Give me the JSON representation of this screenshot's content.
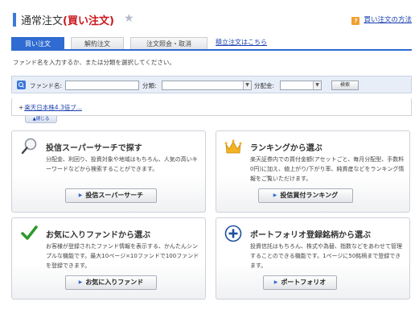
{
  "header": {
    "title_prefix": "通常注文",
    "title_emphasis": "(買い注文)",
    "star_icon": "star-icon",
    "howto_icon": "help-icon",
    "howto_label": "買い注文の方法"
  },
  "tabs": [
    {
      "label": "買い注文",
      "active": true
    },
    {
      "label": "解約注文",
      "active": false
    },
    {
      "label": "注文照会・取消",
      "active": false
    }
  ],
  "tab_link": "積立注文はこちら",
  "instructions": "ファンド名を入力するか、または分類を選択してください。",
  "search": {
    "fund_name_label": "ファンド名:",
    "fund_name_value": "",
    "category_label": "分類:",
    "category_value": "",
    "distribution_label": "分配金:",
    "distribution_value": "",
    "search_button": "検索"
  },
  "recent_mark": "+",
  "recent_link": "楽天日本株4.3倍ブ...",
  "close_label": "▲閉じる",
  "cards": [
    {
      "icon": "magnifier-icon",
      "title": "投信スーパーサーチで探す",
      "desc": "分配金、利回り、投資対象や地域はもちろん、人気の高いキーワードなどから検索することができます。",
      "button": "投信スーパーサーチ"
    },
    {
      "icon": "crown-icon",
      "title": "ランキングから選ぶ",
      "desc": "楽天証券内での買付金額(アセットごと、毎月分配型、手数料0円)に加え、値上がり/下がり率、純資産などをランキング情報をご覧いただけます。",
      "button": "投信買付ランキング"
    },
    {
      "icon": "checkmark-icon",
      "title": "お気に入りファンドから選ぶ",
      "desc": "お客様が登録されたファンド情報を表示する、かんたんシンプルな機能です。最大10ページ×10ファンドで100ファンドを登録できます。",
      "button": "お気に入りファンド"
    },
    {
      "icon": "plus-circle-icon",
      "title": "ポートフォリオ登録銘柄から選ぶ",
      "desc": "投資信託はもちろん、株式や為替、指数などをあわせて管理することのできる機能です。1ページに50銘柄まで登録できます。",
      "button": "ポートフォリオ"
    }
  ],
  "colors": {
    "accent": "#2f6bd0",
    "title_red": "#c8161d",
    "help_orange": "#f0a030",
    "search_bg": "#e8eef8"
  }
}
